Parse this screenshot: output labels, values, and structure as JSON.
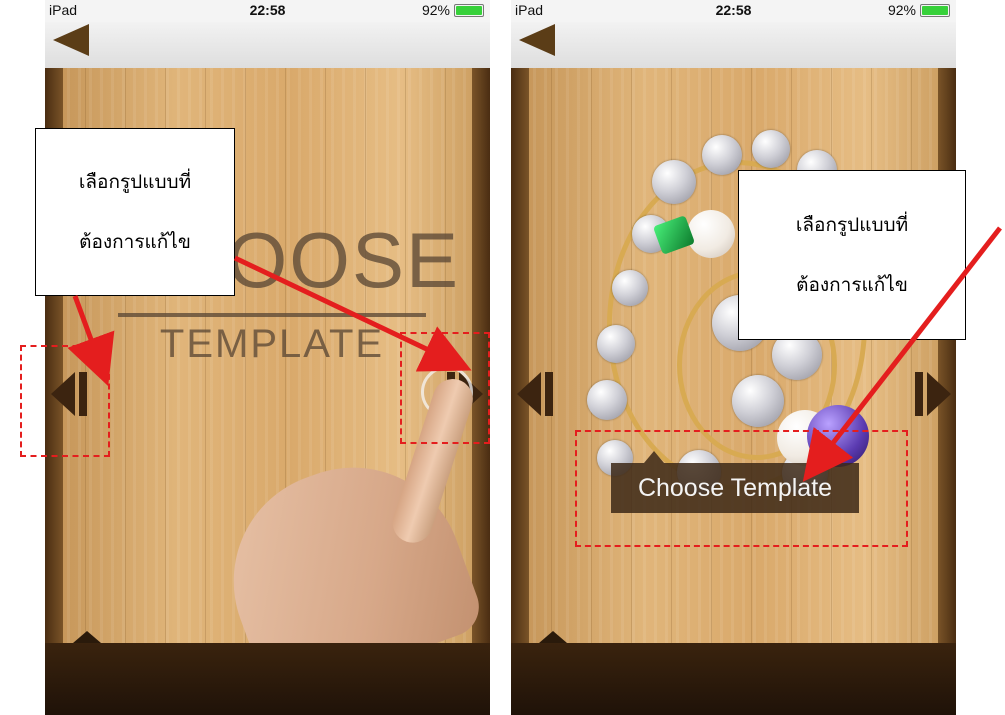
{
  "screens": [
    {
      "status": {
        "carrier": "iPad",
        "time": "22:58",
        "battery": "92%"
      },
      "title_big": "CHOOSE",
      "title_small": "TEMPLATE"
    },
    {
      "status": {
        "carrier": "iPad",
        "time": "22:58",
        "battery": "92%"
      },
      "button": "Choose Template"
    }
  ],
  "annotations": {
    "left_callout": {
      "line1": "เลือกรูปแบบที่",
      "line2": "ต้องการแก้ไข"
    },
    "right_callout": {
      "line1": "เลือกรูปแบบที่",
      "line2": "ต้องการแก้ไข"
    },
    "arrow_color": "#e41e1e"
  },
  "colors": {
    "wood": "#d9a96b",
    "frame": "#4a2d12",
    "battery_fill": "#37d13a"
  }
}
